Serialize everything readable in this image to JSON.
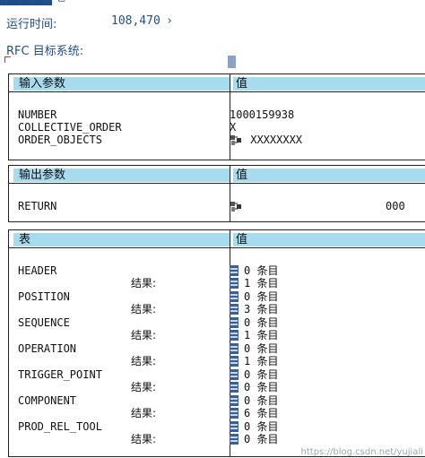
{
  "header": {
    "runtime_label": "运行时间:",
    "runtime_value": "108,470",
    "rfc_label": "RFC 目标系统:"
  },
  "import": {
    "col1": "输入参数",
    "col2": "值",
    "rows": [
      {
        "name": "NUMBER",
        "value": "1000159938"
      },
      {
        "name": "COLLECTIVE_ORDER",
        "value": "X"
      },
      {
        "name": "ORDER_OBJECTS",
        "value": "XXXXXXXX"
      }
    ]
  },
  "export": {
    "col1": "输出参数",
    "col2": "值",
    "rows": [
      {
        "name": "RETURN",
        "value": "000"
      }
    ]
  },
  "tables": {
    "col1": "表",
    "col2": "值",
    "result_label": "结果:",
    "unit": "条目",
    "rows": [
      {
        "name": "HEADER",
        "before": "0",
        "after": "1"
      },
      {
        "name": "POSITION",
        "before": "0",
        "after": "3"
      },
      {
        "name": "SEQUENCE",
        "before": "0",
        "after": "1"
      },
      {
        "name": "OPERATION",
        "before": "0",
        "after": "1"
      },
      {
        "name": "TRIGGER_POINT",
        "before": "0",
        "after": "0"
      },
      {
        "name": "COMPONENT",
        "before": "0",
        "after": "6"
      },
      {
        "name": "PROD_REL_TOOL",
        "before": "0",
        "after": "0"
      }
    ]
  },
  "watermark": "https://blog.csdn.net/yujiali"
}
